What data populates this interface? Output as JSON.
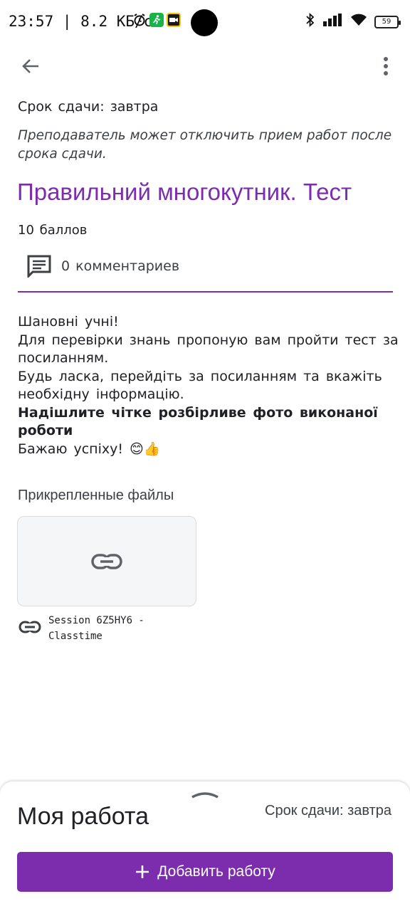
{
  "status_bar": {
    "time": "23:57",
    "speed": "| 8.2 КБ/с",
    "battery": "59",
    "icons": [
      "alarm-icon",
      "run-icon",
      "camera-app-icon",
      "bluetooth-icon",
      "signal-icon",
      "wifi-icon",
      "battery-icon"
    ]
  },
  "toolbar": {
    "back_icon": "arrow-back-icon",
    "menu_icon": "more-vert-icon"
  },
  "assignment": {
    "due_line": "Срок сдачи: завтра",
    "warning": "Преподаватель может отключить прием работ после срока сдачи.",
    "title": "Правильний многокутник. Тест",
    "points": "10 баллов",
    "comments": "0 комментариев",
    "accent_color": "#7b2dad"
  },
  "description": {
    "line1": "Шановні учні!",
    "line2": "Для перевірки знань пропоную вам пройти тест за посиланням.",
    "line3": "Будь ласка, перейдіть за посиланням та вкажіть необхідну інформацію.",
    "line4_bold": "Надішлите чітке розбірливе фото виконаної роботи",
    "line5": "Бажаю успіху! 😊👍"
  },
  "attachments": {
    "title": "Прикрепленные файлы",
    "items": [
      {
        "name": "Session 6Z5HY6 - Classtime",
        "icon": "link-icon"
      }
    ]
  },
  "my_work": {
    "title": "Моя работа",
    "due": "Срок сдачи: завтра",
    "add_button": "Добавить работу",
    "button_color": "#7b2dad"
  }
}
